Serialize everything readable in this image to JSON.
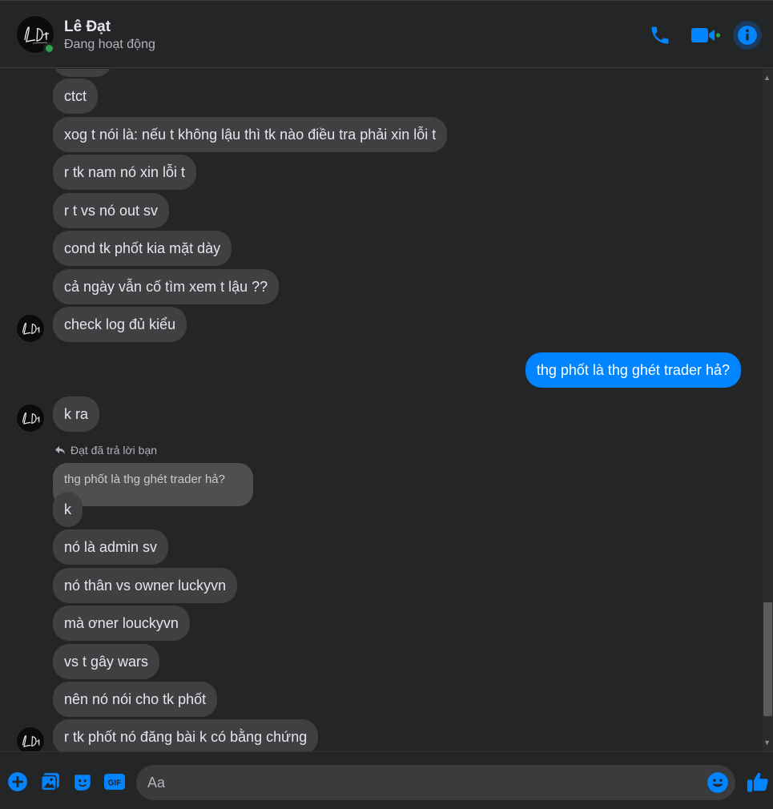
{
  "header": {
    "contact_name": "Lê Đạt",
    "status": "Đang hoạt động",
    "icons": [
      "phone-icon",
      "video-call-icon",
      "info-icon"
    ],
    "accent_color": "#0084ff"
  },
  "messages": [
    {
      "text": "ctct",
      "sender": "contact"
    },
    {
      "text": "xog t nói là: nếu t không lậu thì tk nào điều tra phải xin lỗi t",
      "sender": "contact"
    },
    {
      "text": "r tk nam nó xin lỗi t",
      "sender": "contact"
    },
    {
      "text": "r t vs nó out sv",
      "sender": "contact"
    },
    {
      "text": "cond tk phốt kia mặt dày",
      "sender": "contact"
    },
    {
      "text": "cả ngày vẫn cố tìm xem t lậu ??",
      "sender": "contact"
    },
    {
      "text": "check log đủ kiểu",
      "sender": "contact"
    },
    {
      "text": "thg phốt là thg ghét trader hả?",
      "sender": "me"
    },
    {
      "text": "k ra",
      "sender": "contact"
    },
    {
      "text": "k",
      "sender": "contact"
    },
    {
      "text": "nó là admin sv",
      "sender": "contact"
    },
    {
      "text": "nó thân vs owner luckyvn",
      "sender": "contact"
    },
    {
      "text": "mà ơner louckyvn",
      "sender": "contact"
    },
    {
      "text": "vs t gây wars",
      "sender": "contact"
    },
    {
      "text": "nên nó nói cho tk phốt",
      "sender": "contact"
    },
    {
      "text": "r tk phốt nó đăng bài k có bằng chứng",
      "sender": "contact"
    }
  ],
  "reply": {
    "note": "Đạt đã trả lời bạn",
    "quoted_text": "thg phốt là thg ghét trader hả?"
  },
  "composer": {
    "placeholder": "Aa",
    "icons": [
      "add-icon",
      "photo-icon",
      "sticker-icon",
      "gif-icon",
      "emoji-icon",
      "like-icon"
    ],
    "gif_label": "GIF"
  }
}
